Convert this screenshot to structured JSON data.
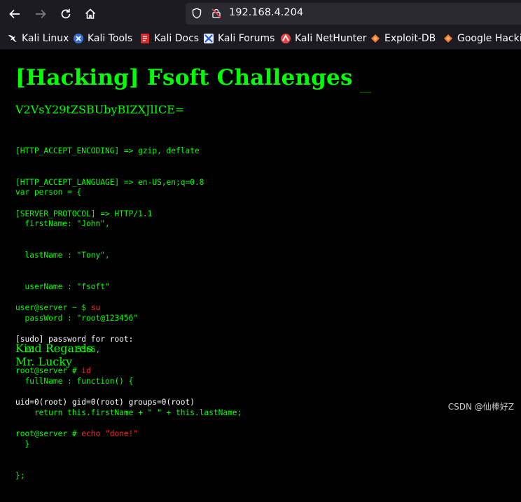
{
  "browser": {
    "url": "192.168.4.204",
    "bookmarks": [
      {
        "label": "Kali Linux",
        "icon": "kali-dragon-icon"
      },
      {
        "label": "Kali Tools",
        "icon": "kali-tools-icon"
      },
      {
        "label": "Kali Docs",
        "icon": "kali-docs-icon"
      },
      {
        "label": "Kali Forums",
        "icon": "kali-forums-icon"
      },
      {
        "label": "Kali NetHunter",
        "icon": "kali-nethunter-icon"
      },
      {
        "label": "Exploit-DB",
        "icon": "exploit-db-icon"
      },
      {
        "label": "Google Hacking",
        "icon": "google-hacking-icon"
      }
    ]
  },
  "page": {
    "title": "[Hacking] Fsoft Challenges",
    "encoded_string": "V2VsY29tZSBUbyBIZXJlICE=",
    "headers": [
      "[HTTP_ACCEPT_ENCODING] => gzip, deflate",
      "[HTTP_ACCEPT_LANGUAGE] => en-US,en;q=0.8",
      "[SERVER_PROTOCOL] => HTTP/1.1"
    ],
    "code_lines": [
      "var person = {",
      "  firstName: \"John\",",
      "  lastName : \"Tony\",",
      "  userName : \"fsoft\"",
      "  passWord : \"root@123456\"",
      "  id       : 5566,",
      "  fullName : function() {",
      "    return this.firstName + \" \" + this.lastName;",
      "  }",
      "};"
    ],
    "terminal": {
      "prompt_user": "user@server ~ $ ",
      "cmd_su": "su",
      "sudo_line": "[sudo] password for root:",
      "prompt_root": "root@server # ",
      "cmd_id": "id",
      "id_output": "uid=0(root) gid=0(root) groups=0(root)",
      "cmd_echo": "echo \"done!\""
    },
    "regards": "Kind Regards",
    "signature": "Mr. Lucky"
  },
  "watermark": "CSDN @仙棒好Z",
  "colors": {
    "accent_green": "#00ff00",
    "command_red": "#ff2222",
    "background": "#000000"
  }
}
